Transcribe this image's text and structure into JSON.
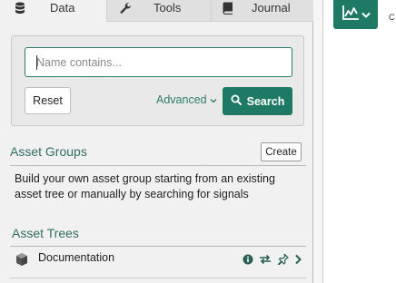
{
  "tabs": [
    {
      "label": "Data",
      "icon": "database-icon",
      "active": true
    },
    {
      "label": "Tools",
      "icon": "wrench-icon",
      "active": false
    },
    {
      "label": "Journal",
      "icon": "book-icon",
      "active": false
    }
  ],
  "search": {
    "placeholder": "Name contains...",
    "value": "",
    "reset_label": "Reset",
    "advanced_label": "Advanced",
    "search_label": "Search"
  },
  "asset_groups": {
    "title": "Asset Groups",
    "create_label": "Create",
    "description": "Build your own asset group starting from an existing asset tree or manually by searching for signals"
  },
  "asset_trees": {
    "title": "Asset Trees",
    "items": [
      {
        "label": "Documentation",
        "icon": "cube-icon"
      }
    ]
  },
  "toolbar": {
    "chart_icon": "line-chart-icon",
    "partial_text": "C"
  },
  "colors": {
    "accent": "#1f7a65",
    "section_title": "#2f6e60"
  }
}
